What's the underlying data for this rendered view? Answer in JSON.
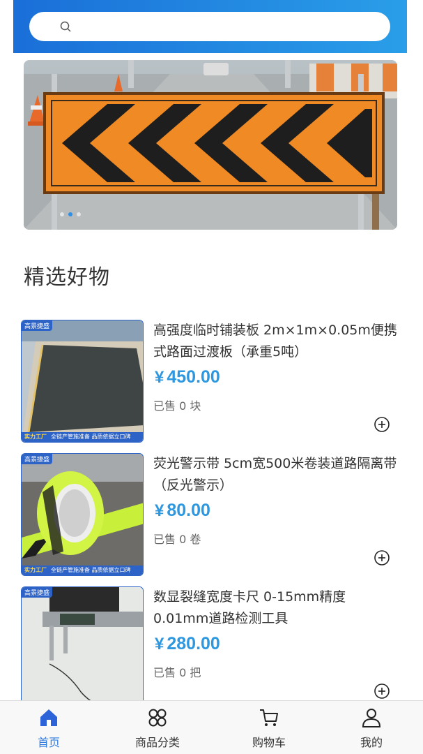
{
  "search": {
    "placeholder": "",
    "icon": "search-icon"
  },
  "banner": {
    "slides": 3,
    "active": 1
  },
  "section": {
    "title": "精选好物"
  },
  "currency": "¥",
  "products": [
    {
      "name": "高强度临时铺装板 2m×1m×0.05m便携式路面过渡板（承重5吨）",
      "price": "450.00",
      "sold": "已售 0 块",
      "tag": "高景捷盛",
      "foot_brand": "实力工厂",
      "foot_text": "全链产管施准备 品质依据立口碑"
    },
    {
      "name": "荧光警示带 5cm宽500米卷装道路隔离带（反光警示）",
      "price": "80.00",
      "sold": "已售 0 卷",
      "tag": "高景捷盛",
      "foot_brand": "实力工厂",
      "foot_text": "全链产管施准备 品质依据立口碑"
    },
    {
      "name": "数显裂缝宽度卡尺 0-15mm精度0.01mm道路检测工具",
      "price": "280.00",
      "sold": "已售 0 把",
      "tag": "高景捷盛"
    }
  ],
  "tabbar": [
    {
      "label": "首页",
      "icon": "home-icon",
      "active": true
    },
    {
      "label": "商品分类",
      "icon": "category-icon",
      "active": false
    },
    {
      "label": "购物车",
      "icon": "cart-icon",
      "active": false
    },
    {
      "label": "我的",
      "icon": "user-icon",
      "active": false
    }
  ],
  "colors": {
    "accent": "#2d7be0",
    "price": "#2d97e0",
    "header": "#1a6fd8"
  }
}
